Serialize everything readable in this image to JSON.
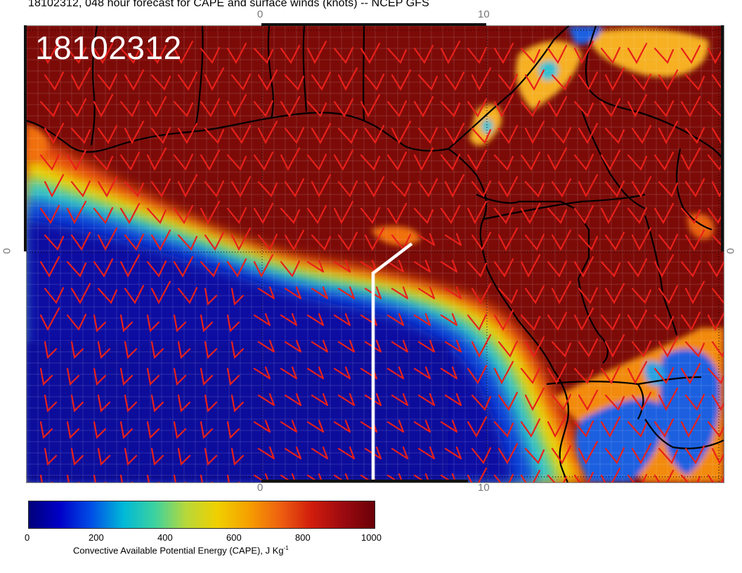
{
  "figure": {
    "title": "18102312, 048 hour forecast for CAPE and surface winds (knots) -- NCEP GFS",
    "stamp": "18102312"
  },
  "axes": {
    "top": [
      "0",
      "10"
    ],
    "bottom": [
      "0",
      "10"
    ],
    "left": [
      "0"
    ],
    "right": [
      "0"
    ]
  },
  "colorbar": {
    "ticks": [
      "0",
      "200",
      "400",
      "600",
      "800",
      "1000"
    ],
    "label": "Convective Available Potential Energy (CAPE), J Kg",
    "label_superscript": "-1",
    "range": [
      0,
      1000
    ],
    "colors": [
      "#00007a",
      "#0000c8",
      "#0050e6",
      "#00b8d8",
      "#3cd2a0",
      "#b8d83a",
      "#f0d000",
      "#f6a000",
      "#ee6010",
      "#d01c0c",
      "#9c0a10",
      "#6a0008"
    ]
  },
  "layers": {
    "field": "CAPE",
    "wind_barb_color": "#e8201a",
    "coastline_color": "#000000",
    "highlight_path_color": "#ffffff"
  }
}
